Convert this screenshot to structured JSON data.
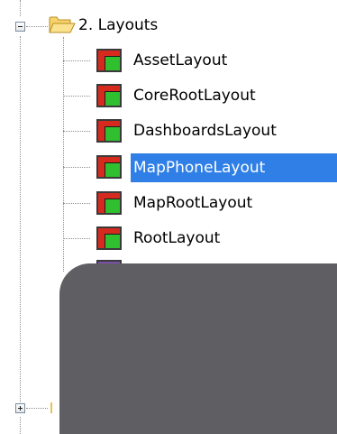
{
  "tree": {
    "folder": {
      "label": "2. Layouts",
      "icon": "folder-open-icon",
      "expanded": true
    },
    "items": [
      {
        "label": "AssetLayout",
        "icon": "layout-icon",
        "selected": false
      },
      {
        "label": "CoreRootLayout",
        "icon": "layout-icon",
        "selected": false
      },
      {
        "label": "DashboardsLayout",
        "icon": "layout-icon",
        "selected": false
      },
      {
        "label": "MapPhoneLayout",
        "icon": "layout-icon",
        "selected": true
      },
      {
        "label": "MapRootLayout",
        "icon": "layout-icon",
        "selected": false
      },
      {
        "label": "RootLayout",
        "icon": "layout-icon",
        "selected": false
      }
    ],
    "collapsed_node": {
      "expanded": false
    }
  },
  "colors": {
    "selection": "#2f7fe6",
    "overlay": "#5f5f63",
    "icon_red": "#d62a1f",
    "icon_green": "#2fbf2f"
  }
}
